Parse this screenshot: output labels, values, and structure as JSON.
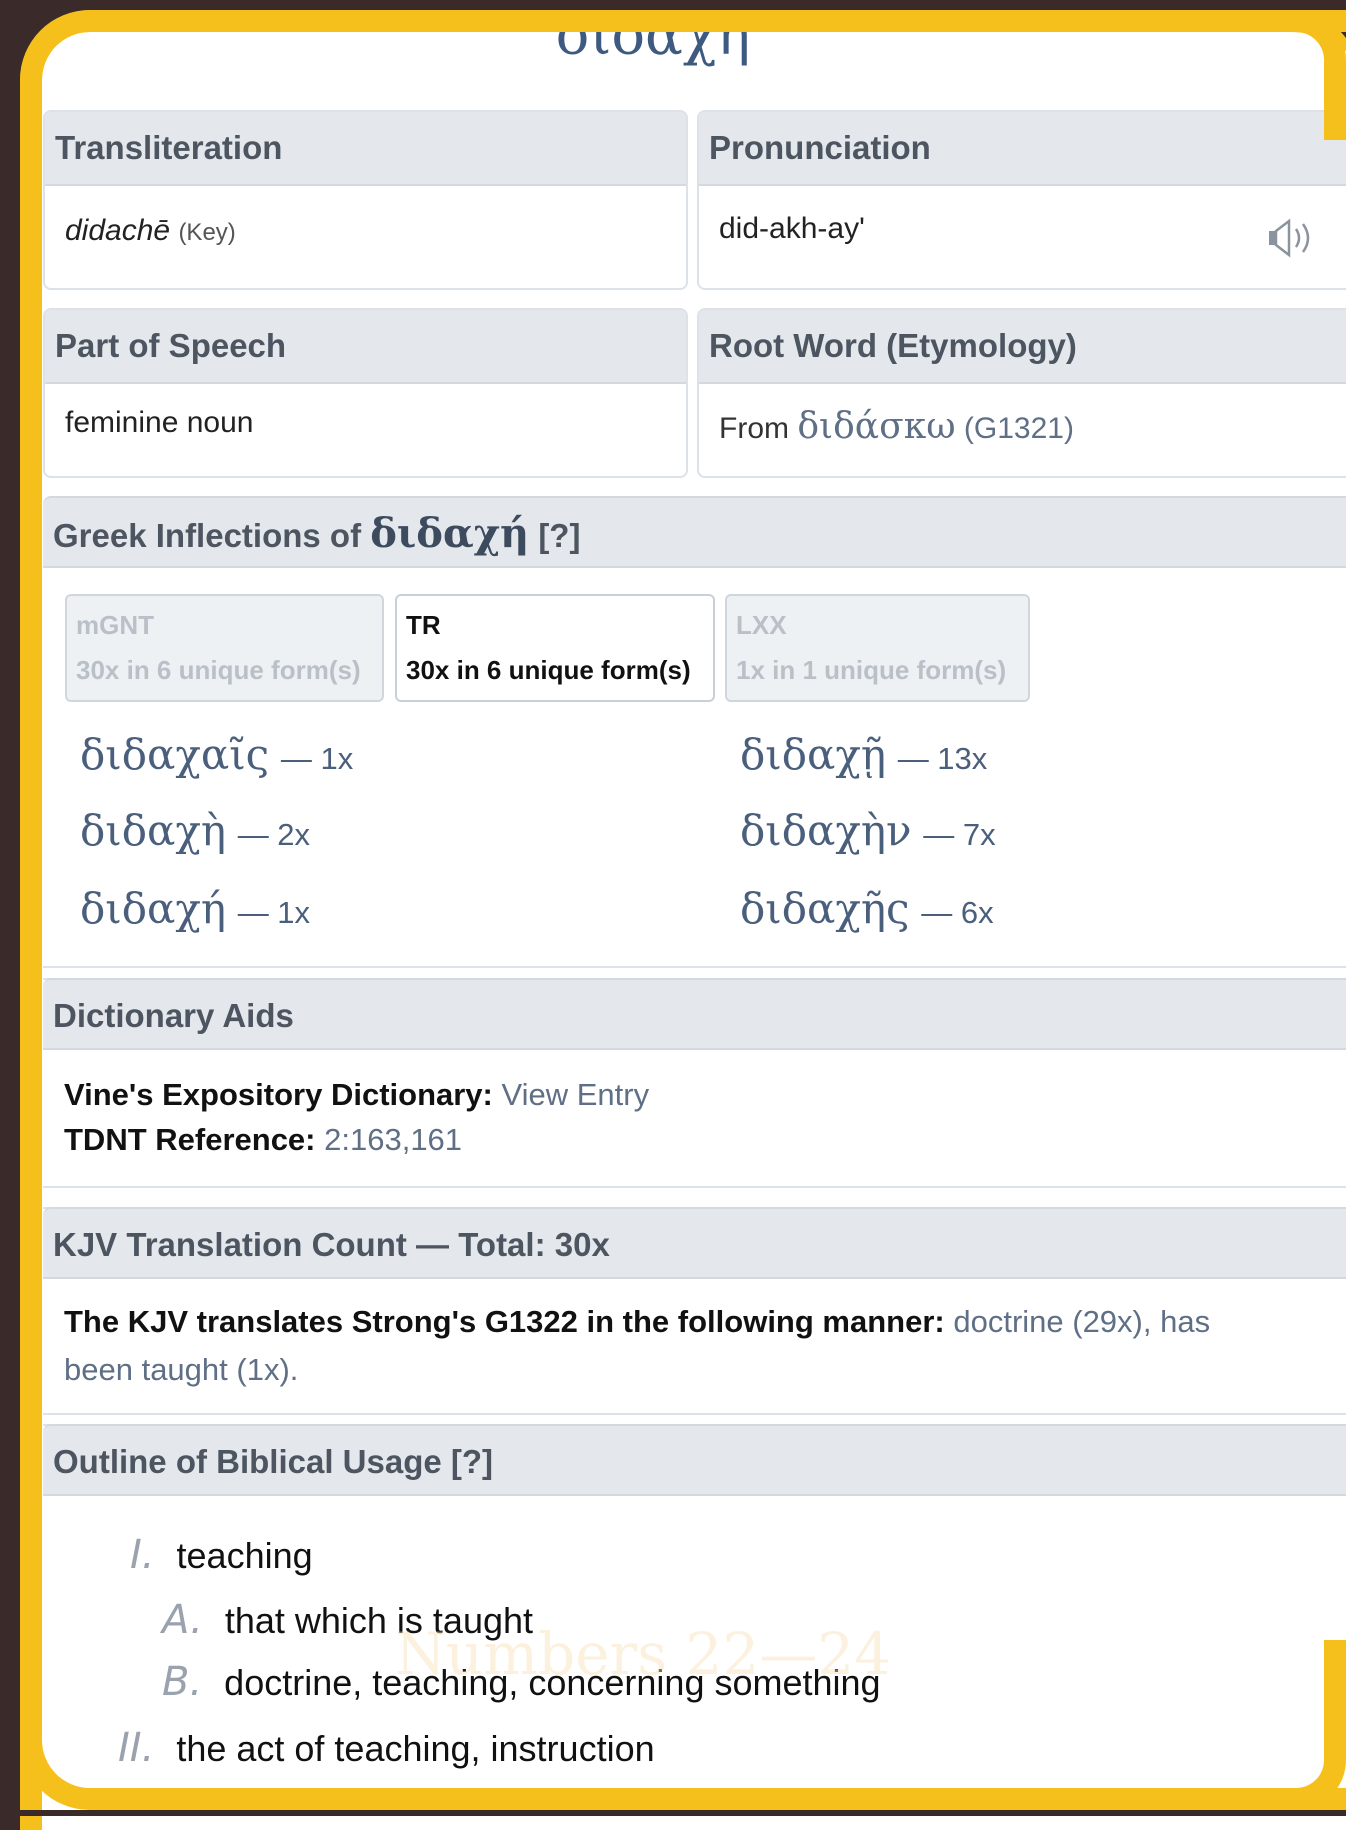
{
  "title": "διδαχή",
  "transliteration": {
    "label": "Transliteration",
    "value": "didachē",
    "key": "(Key)"
  },
  "pronunciation": {
    "label": "Pronunciation",
    "value": "did-akh-ay'",
    "speaker_icon": "speaker-icon"
  },
  "part_of_speech": {
    "label": "Part of Speech",
    "value": "feminine noun"
  },
  "root_word": {
    "label": "Root Word (Etymology)",
    "prefix": "From",
    "greek": "διδάσκω",
    "ref": "(G1321)"
  },
  "inflections": {
    "heading_prefix": "Greek Inflections of",
    "heading_greek": "διδαχή",
    "heading_help": "[?]",
    "tabs": [
      {
        "name": "mGNT",
        "count": "30x in 6 unique form(s)",
        "active": false
      },
      {
        "name": "TR",
        "count": "30x in 6 unique form(s)",
        "active": true
      },
      {
        "name": "LXX",
        "count": "1x in 1 unique form(s)",
        "active": false
      }
    ],
    "forms": [
      {
        "greek": "διδαχαῖς",
        "count": "— 1x"
      },
      {
        "greek": "διδαχῇ",
        "count": "— 13x"
      },
      {
        "greek": "διδαχὴ",
        "count": "— 2x"
      },
      {
        "greek": "διδαχὴν",
        "count": "— 7x"
      },
      {
        "greek": "διδαχή",
        "count": "— 1x"
      },
      {
        "greek": "διδαχῆς",
        "count": "— 6x"
      }
    ]
  },
  "dictionary_aids": {
    "heading": "Dictionary Aids",
    "vine_label": "Vine's Expository Dictionary:",
    "vine_link": "View Entry",
    "tdnt_label": "TDNT Reference:",
    "tdnt_value": "2:163,161"
  },
  "kjv": {
    "heading": "KJV Translation Count — Total: 30x",
    "intro": "The KJV translates Strong's G1322 in the following manner:",
    "line1_rest": "doctrine (29x), has",
    "line2": "been taught (1x)."
  },
  "outline": {
    "heading": "Outline of Biblical Usage [?]",
    "items": [
      {
        "num": "I.",
        "text": "teaching"
      },
      {
        "num": "A.",
        "text": "that which is taught"
      },
      {
        "num": "B.",
        "text": "doctrine, teaching, concerning something"
      },
      {
        "num": "II.",
        "text": "the act of teaching, instruction"
      }
    ]
  },
  "watermark": "Numbers 22—24"
}
